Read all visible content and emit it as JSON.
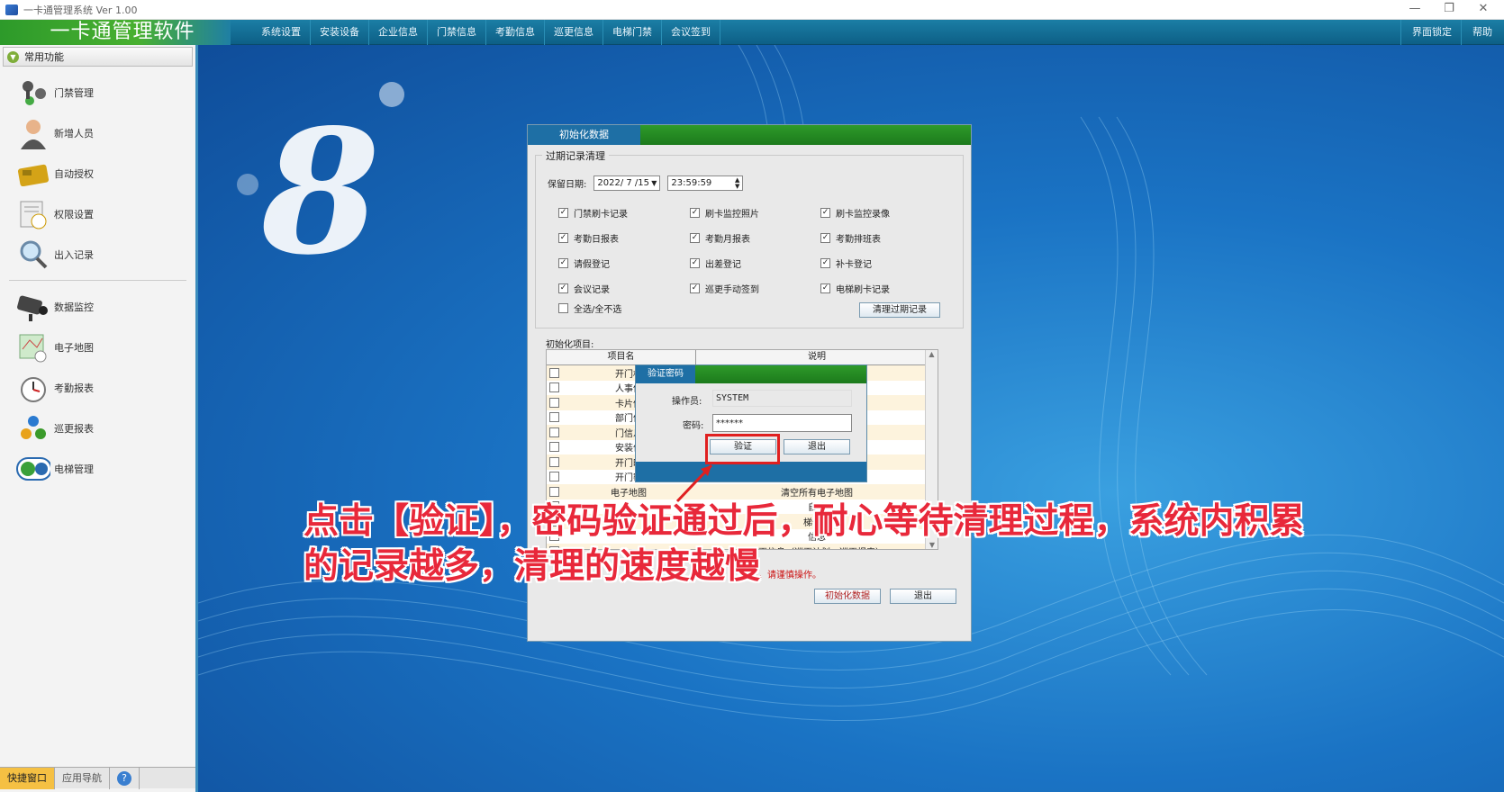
{
  "window": {
    "title": "一卡通管理系统  Ver 1.00",
    "controls": [
      "—",
      "❐",
      "✕"
    ]
  },
  "topbar": {
    "brand": "一卡通管理软件",
    "menus": [
      "系统设置",
      "安装设备",
      "企业信息",
      "门禁信息",
      "考勤信息",
      "巡更信息",
      "电梯门禁",
      "会议签到"
    ],
    "lock": "界面锁定",
    "help": "帮助"
  },
  "sidebar": {
    "header": "常用功能",
    "group1": [
      "门禁管理",
      "新增人员",
      "自动授权",
      "权限设置",
      "出入记录"
    ],
    "group2": [
      "数据监控",
      "电子地图",
      "考勤报表",
      "巡更报表",
      "电梯管理"
    ],
    "tabs": [
      "快捷窗口",
      "应用导航"
    ],
    "help_icon": "?"
  },
  "init_dialog": {
    "title": "初始化数据",
    "group_title": "过期记录清理",
    "date_label": "保留日期:",
    "date_value": "2022/ 7 /15",
    "time_value": "23:59:59",
    "checkboxes": [
      {
        "label": "门禁刷卡记录",
        "checked": true
      },
      {
        "label": "刷卡监控照片",
        "checked": true
      },
      {
        "label": "刷卡监控录像",
        "checked": true
      },
      {
        "label": "考勤日报表",
        "checked": true
      },
      {
        "label": "考勤月报表",
        "checked": true
      },
      {
        "label": "考勤排班表",
        "checked": true
      },
      {
        "label": "请假登记",
        "checked": true
      },
      {
        "label": "出差登记",
        "checked": true
      },
      {
        "label": "补卡登记",
        "checked": true
      },
      {
        "label": "会议记录",
        "checked": true
      },
      {
        "label": "巡更手动签到",
        "checked": true
      },
      {
        "label": "电梯刷卡记录",
        "checked": true
      }
    ],
    "select_all": "全选/全不选",
    "clean_button": "清理过期记录",
    "items_label": "初始化项目:",
    "columns": [
      "项目名",
      "说明"
    ],
    "rows": [
      {
        "name": "开门权",
        "desc": ""
      },
      {
        "name": "人事信",
        "desc": ""
      },
      {
        "name": "卡片信",
        "desc": ""
      },
      {
        "name": "部门信",
        "desc": ""
      },
      {
        "name": "门信息",
        "desc": ""
      },
      {
        "name": "安装位",
        "desc": ""
      },
      {
        "name": "开门时",
        "desc": ""
      },
      {
        "name": "开门密",
        "desc": ""
      },
      {
        "name": "电子地图",
        "desc": "清空所有电子地图"
      },
      {
        "name": "",
        "desc": "自动"
      },
      {
        "name": "",
        "desc": "梯信息"
      },
      {
        "name": "",
        "desc": "信息"
      },
      {
        "name": "",
        "desc": "巡更信息（巡更计划、巡更报表）"
      }
    ],
    "warning": "慎，请谨慎操作。",
    "init_button": "初始化数据",
    "exit_button": "退出"
  },
  "password_dialog": {
    "title": "验证密码",
    "operator_label": "操作员:",
    "operator_value": "SYSTEM",
    "password_label": "密码:",
    "password_value": "******",
    "verify_button": "验证",
    "exit_button": "退出"
  },
  "caption": {
    "line1": "点击【验证】，密码验证通过后，耐心等待清理过程，系统内积累",
    "line2": "的记录越多，清理的速度越慢"
  },
  "colors": {
    "caption": "#e8283a",
    "highlight": "#e02020",
    "titlebar_blue": "#1e6fa5",
    "titlebar_green": "#2e9a2a"
  }
}
